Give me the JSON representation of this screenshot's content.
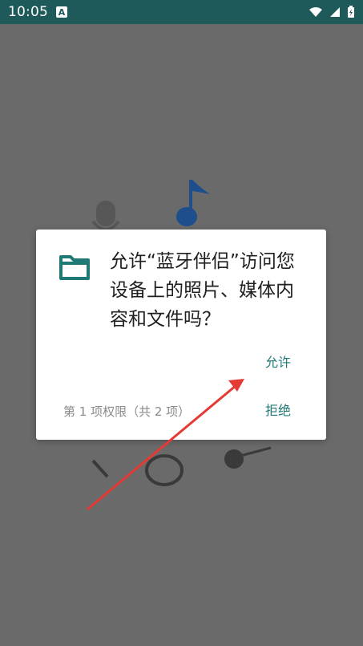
{
  "status_bar": {
    "time": "10:05",
    "notification_icon_letter": "A"
  },
  "dialog": {
    "icon": "folder-icon",
    "message": "允许“蓝牙伴侣”访问您设备上的照片、媒体内容和文件吗？",
    "allow_label": "允许",
    "deny_label": "拒绝",
    "permission_count": "第 1 项权限（共 2 项）"
  },
  "colors": {
    "status_bar_bg": "#1f5a5a",
    "accent": "#1f7a76",
    "scrim": "#6a6a6a",
    "annotation_arrow": "#e53935"
  }
}
